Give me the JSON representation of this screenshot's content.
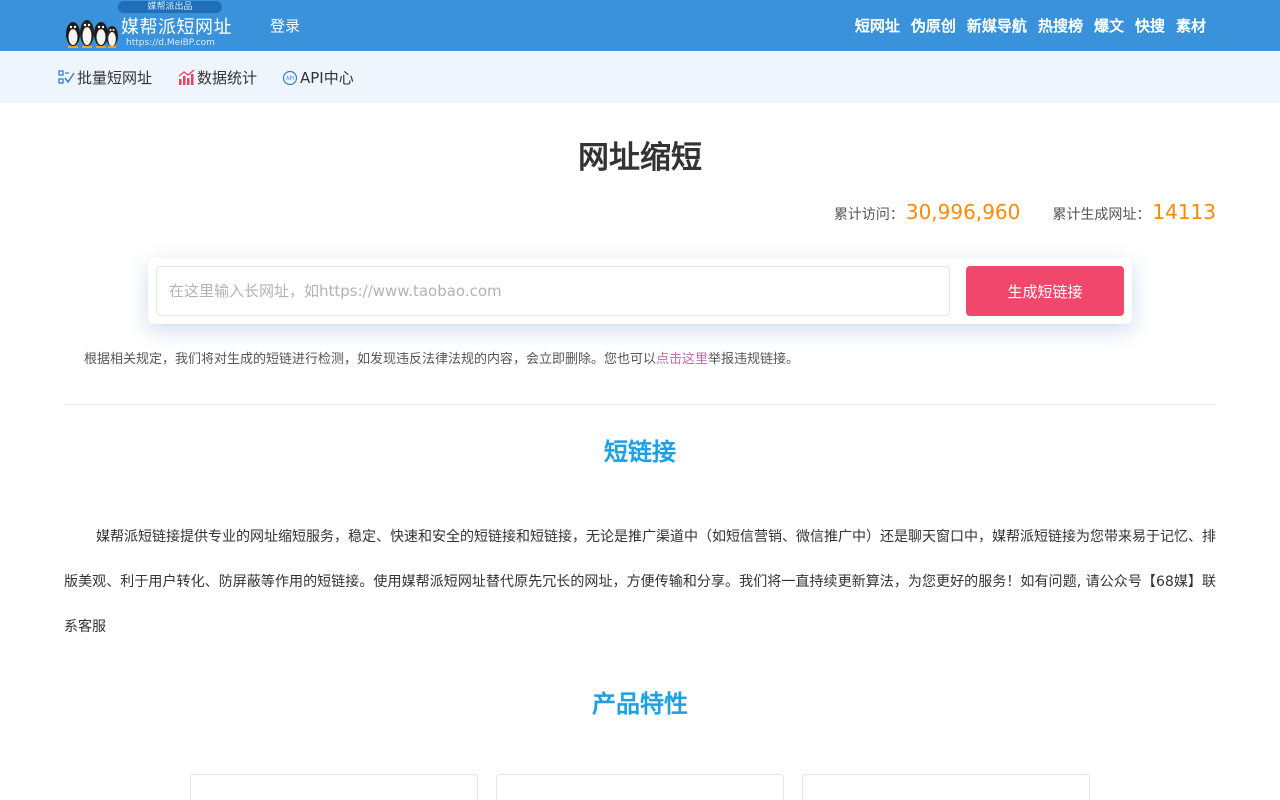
{
  "header": {
    "logo_tag": "媒帮派出品",
    "logo_name": "媒帮派短网址",
    "logo_url": "https://d.MeiBP.com",
    "login": "登录",
    "nav": [
      "短网址",
      "伪原创",
      "新媒导航",
      "热搜榜",
      "爆文",
      "快搜",
      "素材"
    ]
  },
  "subnav": {
    "batch": "批量短网址",
    "stats": "数据统计",
    "api": "API中心"
  },
  "main": {
    "title": "网址缩短",
    "visits_label": "累计访问：",
    "visits_value": "30,996,960",
    "generated_label": "累计生成网址：",
    "generated_value": "14113",
    "input_placeholder": "在这里输入长网址，如https://www.taobao.com",
    "input_value": "",
    "button": "生成短链接",
    "notice_before": "根据相关规定，我们将对生成的短链进行检测，如发现违反法律法规的内容，会立即删除。您也可以",
    "notice_link": "点击这里",
    "notice_after": "举报违规链接。"
  },
  "section1": {
    "title": "短链接",
    "body": "媒帮派短链接提供专业的网址缩短服务，稳定、快速和安全的短链接和短链接，无论是推广渠道中（如短信营销、微信推广中）还是聊天窗口中，媒帮派短链接为您带来易于记忆、排版美观、利于用户转化、防屏蔽等作用的短链接。使用媒帮派短网址替代原先冗长的网址，方便传输和分享。我们将一直持续更新算法，为您更好的服务！如有问题, 请公众号【68媒】联系客服"
  },
  "section2": {
    "title": "产品特性"
  },
  "colors": {
    "header_bg": "#3a92db",
    "subnav_bg": "#eef5fc",
    "accent_button": "#f1476d",
    "stat_number": "#ff8a00",
    "section_title": "#1da1e2",
    "notice_link": "#c46ab8"
  },
  "icons": [
    "penguins-logo",
    "checklist-icon",
    "bar-chart-icon",
    "api-icon"
  ]
}
